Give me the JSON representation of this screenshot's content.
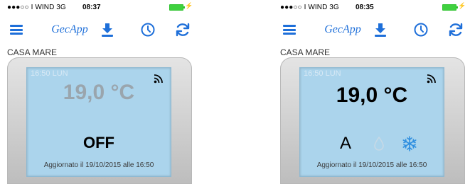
{
  "screens": [
    {
      "status_bar": {
        "carrier": "●●●○○ I WIND  3G",
        "time": "08:37"
      },
      "nav": {
        "brand": "GecApp"
      },
      "house_label": "CASA MARE",
      "display": {
        "clock": "16:50 LUN",
        "temperature": "19,0 °C",
        "state": "OFF",
        "updated": "Aggiornato il 19/10/2015 alle 16:50"
      }
    },
    {
      "status_bar": {
        "carrier": "●●●○○ I WIND  3G",
        "time": "08:35"
      },
      "nav": {
        "brand": "GecApp"
      },
      "house_label": "CASA MARE",
      "display": {
        "clock": "16:50 LUN",
        "temperature": "19,0 °C",
        "mode": "A",
        "updated": "Aggiornato il 19/10/2015 alle 16:50"
      }
    }
  ],
  "colors": {
    "accent": "#1e6fd9",
    "lcd": "#abd4ec",
    "battery": "#3fd13f",
    "snow": "#2f8fe0"
  },
  "icons": [
    "menu-icon",
    "download-icon",
    "clock-icon",
    "sync-icon",
    "wifi-icon",
    "drop-icon",
    "snowflake-icon"
  ]
}
